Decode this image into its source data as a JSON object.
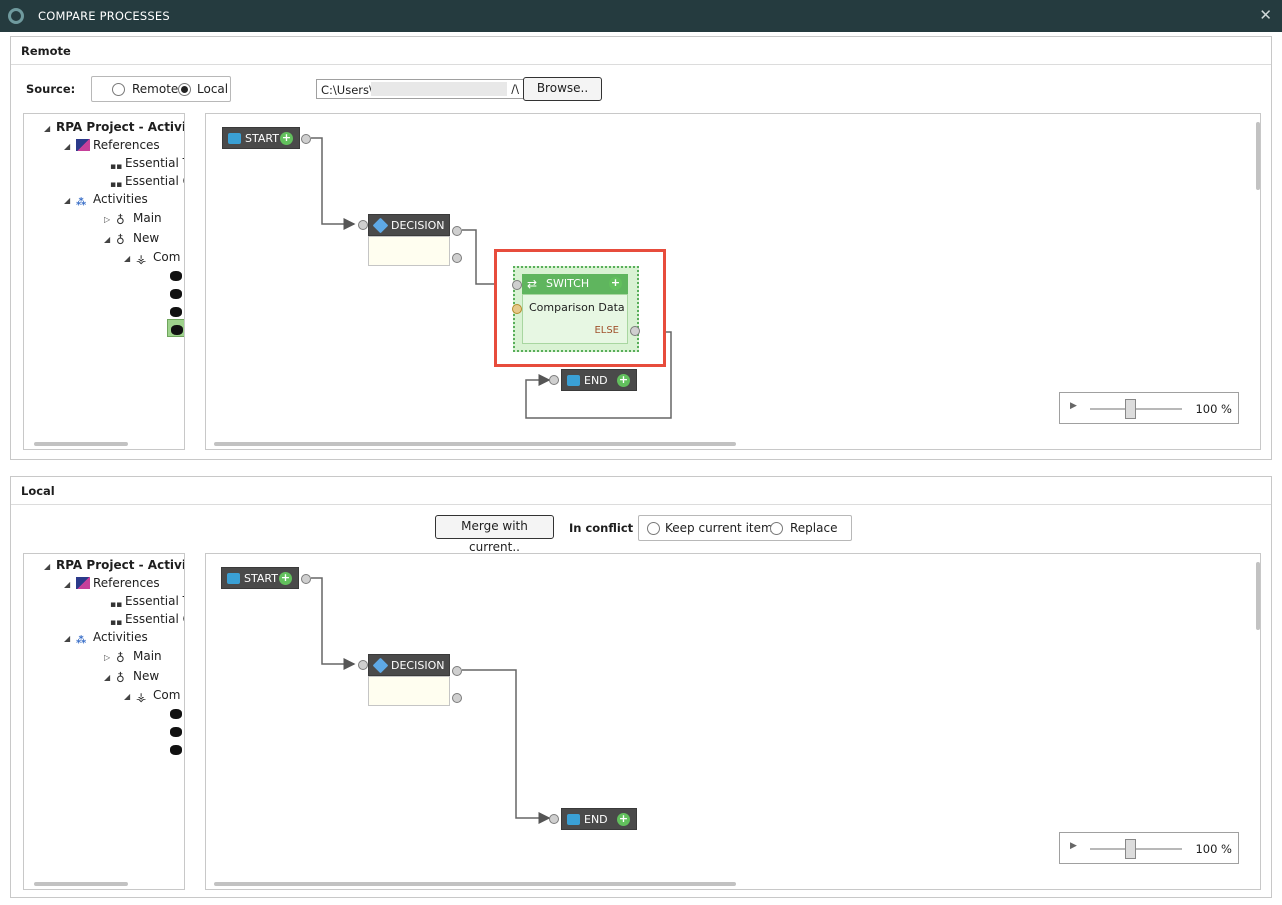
{
  "window": {
    "title": "COMPARE PROCESSES",
    "close_glyph": "✕"
  },
  "remote_panel": {
    "header": "Remote",
    "source_label": "Source:",
    "source_options": [
      "Remote",
      "Local"
    ],
    "source_selected": "Local",
    "path_value": "C:\\Users\\",
    "path_tail": "/\\",
    "browse_label": "Browse..",
    "tree": [
      {
        "label": "RPA Project - Activity (",
        "icon": "none",
        "expander": "◢"
      },
      {
        "label": "References",
        "icon": "references-icon",
        "expander": "◢"
      },
      {
        "label": "Essential Toc",
        "icon": "module-icon",
        "expander": ""
      },
      {
        "label": "Essential Co",
        "icon": "module-icon",
        "expander": ""
      },
      {
        "label": "Activities",
        "icon": "activities-icon",
        "expander": "◢"
      },
      {
        "label": "Main",
        "icon": "flowchart-icon",
        "expander": "▷"
      },
      {
        "label": "New",
        "icon": "flowchart-icon",
        "expander": "◢"
      },
      {
        "label": "Com",
        "icon": "compare-icon",
        "expander": "◢"
      },
      {
        "label": "E",
        "icon": "node-icon",
        "expander": ""
      },
      {
        "label": "E",
        "icon": "node-icon",
        "expander": ""
      },
      {
        "label": "D",
        "icon": "node-icon",
        "expander": ""
      },
      {
        "label": "S",
        "icon": "node-icon",
        "expander": ""
      }
    ],
    "canvas": {
      "start_label": "START",
      "decision_label": "DECISION",
      "switch_label": "SWITCH",
      "switch_comparison": "Comparison Data",
      "switch_else": "ELSE",
      "end_label": "END"
    },
    "zoom": "100 %"
  },
  "local_panel": {
    "header": "Local",
    "merge_label": "Merge with current..",
    "conflict_label": "In conflict :",
    "conflict_options": [
      "Keep current items",
      "Replace"
    ],
    "tree": [
      {
        "label": "RPA Project - Activity (",
        "icon": "none",
        "expander": "◢"
      },
      {
        "label": "References",
        "icon": "references-icon",
        "expander": "◢"
      },
      {
        "label": "Essential Toc",
        "icon": "module-icon",
        "expander": ""
      },
      {
        "label": "Essential Co",
        "icon": "module-icon",
        "expander": ""
      },
      {
        "label": "Activities",
        "icon": "activities-icon",
        "expander": "◢"
      },
      {
        "label": "Main",
        "icon": "flowchart-icon",
        "expander": "▷"
      },
      {
        "label": "New",
        "icon": "flowchart-icon",
        "expander": "◢"
      },
      {
        "label": "Com",
        "icon": "compare-icon",
        "expander": "◢"
      },
      {
        "label": "E",
        "icon": "node-icon",
        "expander": ""
      },
      {
        "label": "E",
        "icon": "node-icon",
        "expander": ""
      },
      {
        "label": "D",
        "icon": "node-icon",
        "expander": ""
      }
    ],
    "canvas": {
      "start_label": "START",
      "decision_label": "DECISION",
      "end_label": "END"
    },
    "zoom": "100 %"
  }
}
